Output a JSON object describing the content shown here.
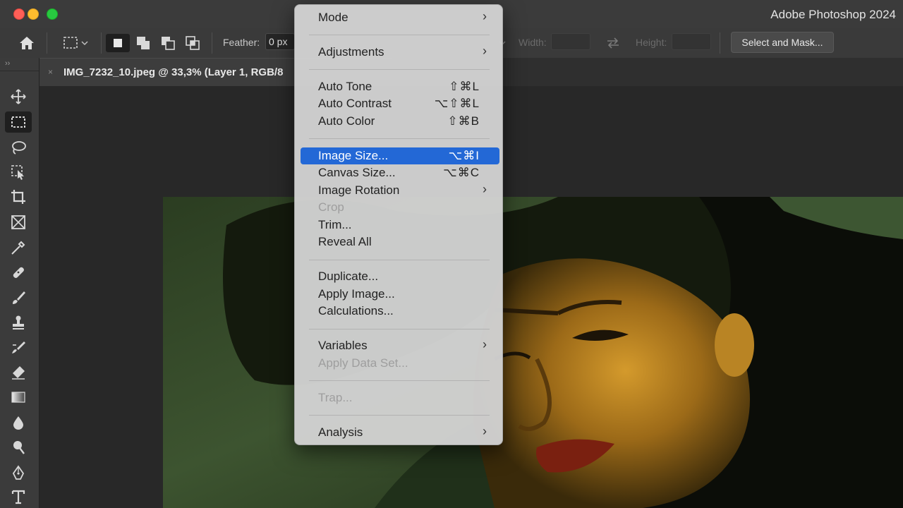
{
  "window": {
    "title": "Adobe Photoshop 2024"
  },
  "options_bar": {
    "feather_label": "Feather:",
    "feather_value": "0 px",
    "width_label": "Width:",
    "height_label": "Height:",
    "select_mask_label": "Select and Mask..."
  },
  "toolbar": {
    "collapse_glyph": "››",
    "tools": [
      "move",
      "rectangular-marquee",
      "lasso",
      "object-selection",
      "crop",
      "frame",
      "eyedropper",
      "spot-healing",
      "brush",
      "clone-stamp",
      "history-brush",
      "eraser",
      "gradient",
      "blur",
      "dodge",
      "pen",
      "type"
    ],
    "active_tool": "rectangular-marquee"
  },
  "document": {
    "tab_close": "×",
    "tab_title": "IMG_7232_10.jpeg @ 33,3% (Layer 1, RGB/8"
  },
  "menu": {
    "items": [
      {
        "label": "Mode",
        "shortcut": "",
        "submenu": "›"
      },
      {
        "label": "Adjustments",
        "shortcut": "",
        "submenu": "›"
      },
      {
        "label": "Auto Tone",
        "shortcut": "⇧⌘L"
      },
      {
        "label": "Auto Contrast",
        "shortcut": "⌥⇧⌘L"
      },
      {
        "label": "Auto Color",
        "shortcut": "⇧⌘B"
      },
      {
        "label": "Image Size...",
        "shortcut": "⌥⌘I"
      },
      {
        "label": "Canvas Size...",
        "shortcut": "⌥⌘C"
      },
      {
        "label": "Image Rotation",
        "shortcut": "",
        "submenu": "›"
      },
      {
        "label": "Crop",
        "shortcut": ""
      },
      {
        "label": "Trim...",
        "shortcut": ""
      },
      {
        "label": "Reveal All",
        "shortcut": ""
      },
      {
        "label": "Duplicate...",
        "shortcut": ""
      },
      {
        "label": "Apply Image...",
        "shortcut": ""
      },
      {
        "label": "Calculations...",
        "shortcut": ""
      },
      {
        "label": "Variables",
        "shortcut": "",
        "submenu": "›"
      },
      {
        "label": "Apply Data Set...",
        "shortcut": ""
      },
      {
        "label": "Trap...",
        "shortcut": ""
      },
      {
        "label": "Analysis",
        "shortcut": "",
        "submenu": "›"
      }
    ],
    "selected": "Image Size...",
    "disabled": [
      "Crop",
      "Apply Data Set...",
      "Trap..."
    ]
  },
  "colors": {
    "menu_highlight": "#2368d6",
    "titlebar": "#3b3b3b",
    "workspace": "#282828"
  }
}
